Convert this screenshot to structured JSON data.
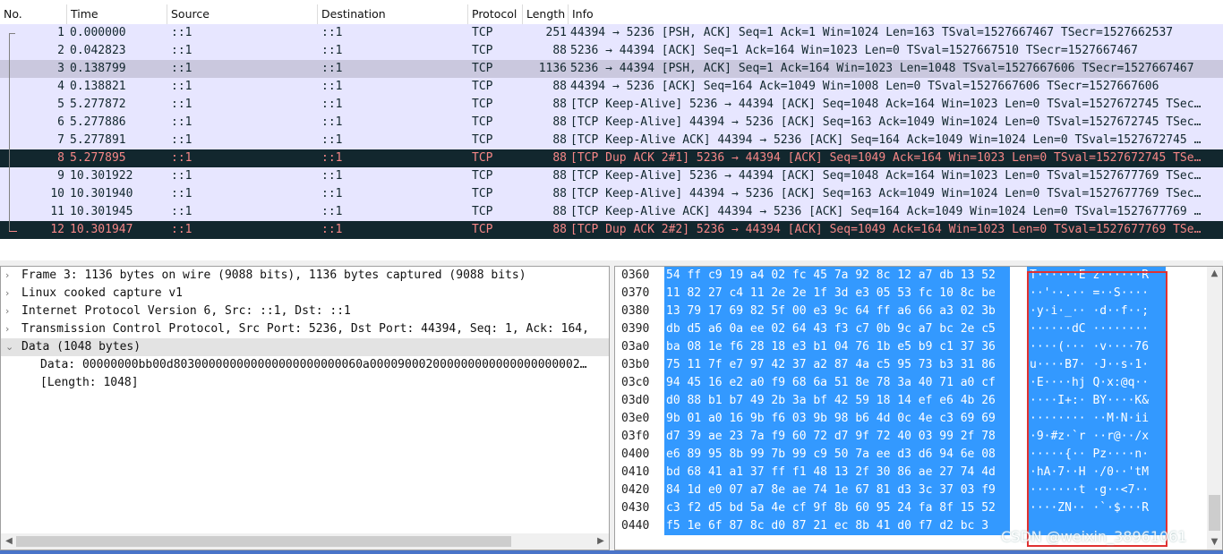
{
  "packet_list": {
    "columns": [
      "No.",
      "Time",
      "Source",
      "Destination",
      "Protocol",
      "Length",
      "Info"
    ],
    "rows": [
      {
        "no": "1",
        "time": "0.000000",
        "src": "::1",
        "dst": "::1",
        "proto": "TCP",
        "len": "251",
        "info": "44394 → 5236 [PSH, ACK] Seq=1 Ack=1 Win=1024 Len=163 TSval=1527667467 TSecr=1527662537",
        "style": "normal"
      },
      {
        "no": "2",
        "time": "0.042823",
        "src": "::1",
        "dst": "::1",
        "proto": "TCP",
        "len": "88",
        "info": "5236 → 44394 [ACK] Seq=1 Ack=164 Win=1023 Len=0 TSval=1527667510 TSecr=1527667467",
        "style": "normal"
      },
      {
        "no": "3",
        "time": "0.138799",
        "src": "::1",
        "dst": "::1",
        "proto": "TCP",
        "len": "1136",
        "info": "5236 → 44394 [PSH, ACK] Seq=1 Ack=164 Win=1023 Len=1048 TSval=1527667606 TSecr=1527667467",
        "style": "selected"
      },
      {
        "no": "4",
        "time": "0.138821",
        "src": "::1",
        "dst": "::1",
        "proto": "TCP",
        "len": "88",
        "info": "44394 → 5236 [ACK] Seq=164 Ack=1049 Win=1008 Len=0 TSval=1527667606 TSecr=1527667606",
        "style": "normal"
      },
      {
        "no": "5",
        "time": "5.277872",
        "src": "::1",
        "dst": "::1",
        "proto": "TCP",
        "len": "88",
        "info": "[TCP Keep-Alive] 5236 → 44394 [ACK] Seq=1048 Ack=164 Win=1023 Len=0 TSval=1527672745 TSec…",
        "style": "normal"
      },
      {
        "no": "6",
        "time": "5.277886",
        "src": "::1",
        "dst": "::1",
        "proto": "TCP",
        "len": "88",
        "info": "[TCP Keep-Alive] 44394 → 5236 [ACK] Seq=163 Ack=1049 Win=1024 Len=0 TSval=1527672745 TSec…",
        "style": "normal"
      },
      {
        "no": "7",
        "time": "5.277891",
        "src": "::1",
        "dst": "::1",
        "proto": "TCP",
        "len": "88",
        "info": "[TCP Keep-Alive ACK] 44394 → 5236 [ACK] Seq=164 Ack=1049 Win=1024 Len=0 TSval=1527672745 …",
        "style": "normal"
      },
      {
        "no": "8",
        "time": "5.277895",
        "src": "::1",
        "dst": "::1",
        "proto": "TCP",
        "len": "88",
        "info": "[TCP Dup ACK 2#1] 5236 → 44394 [ACK] Seq=1049 Ack=164 Win=1023 Len=0 TSval=1527672745 TSe…",
        "style": "dup"
      },
      {
        "no": "9",
        "time": "10.301922",
        "src": "::1",
        "dst": "::1",
        "proto": "TCP",
        "len": "88",
        "info": "[TCP Keep-Alive] 5236 → 44394 [ACK] Seq=1048 Ack=164 Win=1023 Len=0 TSval=1527677769 TSec…",
        "style": "normal"
      },
      {
        "no": "10",
        "time": "10.301940",
        "src": "::1",
        "dst": "::1",
        "proto": "TCP",
        "len": "88",
        "info": "[TCP Keep-Alive] 44394 → 5236 [ACK] Seq=163 Ack=1049 Win=1024 Len=0 TSval=1527677769 TSec…",
        "style": "normal"
      },
      {
        "no": "11",
        "time": "10.301945",
        "src": "::1",
        "dst": "::1",
        "proto": "TCP",
        "len": "88",
        "info": "[TCP Keep-Alive ACK] 44394 → 5236 [ACK] Seq=164 Ack=1049 Win=1024 Len=0 TSval=1527677769 …",
        "style": "normal"
      },
      {
        "no": "12",
        "time": "10.301947",
        "src": "::1",
        "dst": "::1",
        "proto": "TCP",
        "len": "88",
        "info": "[TCP Dup ACK 2#2] 5236 → 44394 [ACK] Seq=1049 Ack=164 Win=1023 Len=0 TSval=1527677769 TSe…",
        "style": "dup"
      }
    ]
  },
  "details": {
    "rows": [
      {
        "arrow": "›",
        "text": "Frame 3: 1136 bytes on wire (9088 bits), 1136 bytes captured (9088 bits)",
        "child": false,
        "selected": false
      },
      {
        "arrow": "›",
        "text": "Linux cooked capture v1",
        "child": false,
        "selected": false
      },
      {
        "arrow": "›",
        "text": "Internet Protocol Version 6, Src: ::1, Dst: ::1",
        "child": false,
        "selected": false
      },
      {
        "arrow": "›",
        "text": "Transmission Control Protocol, Src Port: 5236, Dst Port: 44394, Seq: 1, Ack: 164,",
        "child": false,
        "selected": false
      },
      {
        "arrow": "⌄",
        "text": "Data (1048 bytes)",
        "child": false,
        "selected": true
      },
      {
        "arrow": "",
        "text": "Data: 00000000bb00d803000000000000000000000060a000090002000000000000000000002…",
        "child": true,
        "selected": false
      },
      {
        "arrow": "",
        "text": "[Length: 1048]",
        "child": true,
        "selected": false
      }
    ],
    "scroll_left": "◀",
    "scroll_right": "▶"
  },
  "bytes": {
    "rows": [
      {
        "off": "0360",
        "hex": "54 ff c9 19 a4 02 fc 45  7a 92 8c 12 a7 db 13 52",
        "ascii": "T······E z······R"
      },
      {
        "off": "0370",
        "hex": "11 82 27 c4 11 2e 2e 1f  3d e3 05 53 fc 10 8c be",
        "ascii": "··'··.·· =··S····"
      },
      {
        "off": "0380",
        "hex": "13 79 17 69 82 5f 00 e3  9c 64 ff a6 66 a3 02 3b",
        "ascii": "·y·i·_·· ·d··f··;"
      },
      {
        "off": "0390",
        "hex": "db d5 a6 0a ee 02 64 43  f3 c7 0b 9c a7 bc 2e c5",
        "ascii": "······dC ········"
      },
      {
        "off": "03a0",
        "hex": "ba 08 1e f6 28 18 e3 b1  04 76 1b e5 b9 c1 37 36",
        "ascii": "····(··· ·v····76"
      },
      {
        "off": "03b0",
        "hex": "75 11 7f e7 97 42 37 a2  87 4a c5 95 73 b3 31 86",
        "ascii": "u····B7· ·J··s·1·"
      },
      {
        "off": "03c0",
        "hex": "94 45 16 e2 a0 f9 68 6a  51 8e 78 3a 40 71 a0 cf",
        "ascii": "·E····hj Q·x:@q··"
      },
      {
        "off": "03d0",
        "hex": "d0 88 b1 b7 49 2b 3a bf  42 59 18 14 ef e6 4b 26",
        "ascii": "····I+:· BY····K&"
      },
      {
        "off": "03e0",
        "hex": "9b 01 a0 16 9b f6 03 9b  98 b6 4d 0c 4e c3 69 69",
        "ascii": "········ ··M·N·ii"
      },
      {
        "off": "03f0",
        "hex": "d7 39 ae 23 7a f9 60 72  d7 9f 72 40 03 99 2f 78",
        "ascii": "·9·#z·`r ··r@··/x"
      },
      {
        "off": "0400",
        "hex": "e6 89 95 8b 99 7b 99 c9  50 7a ee d3 d6 94 6e 08",
        "ascii": "·····{·· Pz····n·"
      },
      {
        "off": "0410",
        "hex": "bd 68 41 a1 37 ff f1 48  13 2f 30 86 ae 27 74 4d",
        "ascii": "·hA·7··H ·/0··'tM"
      },
      {
        "off": "0420",
        "hex": "84 1d e0 07 a7 8e ae 74  1e 67 81 d3 3c 37 03 f9",
        "ascii": "·······t ·g··<7··"
      },
      {
        "off": "0430",
        "hex": "c3 f2 d5 bd 5a 4e cf 9f  8b 60 95 24 fa 8f 15 52",
        "ascii": "····ZN·· ·`·$···R"
      },
      {
        "off": "0440",
        "hex": "f5 1e 6f 87 8c d0 87 21  ec 8b 41 d0 f7 d2 bc 3",
        "ascii": ""
      }
    ],
    "scroll_up": "▲",
    "scroll_down": "▼"
  },
  "watermark": "CSDN @weixin_38961061",
  "colors": {
    "row_normal": "#e7e6ff",
    "row_selected": "#cac8de",
    "row_dup_bg": "#12272e",
    "row_dup_fg": "#f78787",
    "bytes_highlight": "#3399ff",
    "annotation_box": "#e03131"
  }
}
